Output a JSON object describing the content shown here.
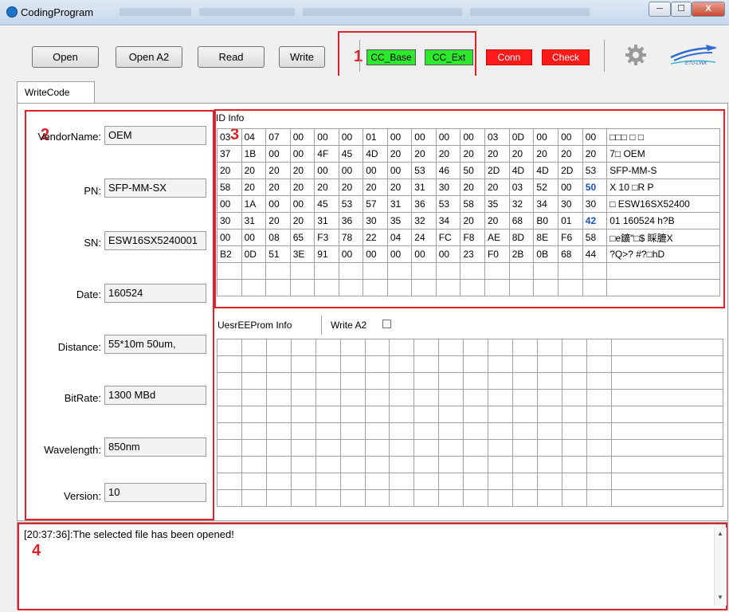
{
  "window": {
    "title": "CodingProgram",
    "controls": [
      "─",
      "☐",
      "X"
    ]
  },
  "toolbar": {
    "buttons": [
      "Open",
      "Open A2",
      "Read",
      "Write"
    ],
    "status": {
      "cc_base": {
        "label": "CC_Base",
        "color": "#2ee82e"
      },
      "cc_ext": {
        "label": "CC_Ext",
        "color": "#2ee82e"
      },
      "conn": {
        "label": "Conn",
        "color": "#ff1a1a"
      },
      "check": {
        "label": "Check",
        "color": "#ff1a1a"
      }
    },
    "logo_text": "ETU-LINK"
  },
  "annotations": [
    "1",
    "2",
    "3",
    "4"
  ],
  "tabs": [
    "WriteCode"
  ],
  "fields": [
    {
      "label": "VendorName:",
      "value": "OEM"
    },
    {
      "label": "PN:",
      "value": "SFP-MM-SX"
    },
    {
      "label": "SN:",
      "value": "ESW16SX5240001"
    },
    {
      "label": "Date:",
      "value": "160524"
    },
    {
      "label": "Distance:",
      "value": "55*10m 50um,"
    },
    {
      "label": "BitRate:",
      "value": "1300 MBd"
    },
    {
      "label": "Wavelength:",
      "value": "850nm"
    },
    {
      "label": "Version:",
      "value": "10"
    }
  ],
  "id_info": {
    "title": "ID Info",
    "rows": [
      {
        "hex": [
          "03",
          "04",
          "07",
          "00",
          "00",
          "00",
          "01",
          "00",
          "00",
          "00",
          "00",
          "03",
          "0D",
          "00",
          "00",
          "00"
        ],
        "text": "□□□  □    □"
      },
      {
        "hex": [
          "37",
          "1B",
          "00",
          "00",
          "4F",
          "45",
          "4D",
          "20",
          "20",
          "20",
          "20",
          "20",
          "20",
          "20",
          "20",
          "20"
        ],
        "text": "7□  OEM"
      },
      {
        "hex": [
          "20",
          "20",
          "20",
          "20",
          "00",
          "00",
          "00",
          "00",
          "53",
          "46",
          "50",
          "2D",
          "4D",
          "4D",
          "2D",
          "53"
        ],
        "text": "          SFP-MM-S"
      },
      {
        "hex": [
          "58",
          "20",
          "20",
          "20",
          "20",
          "20",
          "20",
          "20",
          "31",
          "30",
          "20",
          "20",
          "03",
          "52",
          "00",
          "50"
        ],
        "text": "X         10  □R P"
      },
      {
        "hex": [
          "00",
          "1A",
          "00",
          "00",
          "45",
          "53",
          "57",
          "31",
          "36",
          "53",
          "58",
          "35",
          "32",
          "34",
          "30",
          "30"
        ],
        "text": " □  ESW16SX52400"
      },
      {
        "hex": [
          "30",
          "31",
          "20",
          "20",
          "31",
          "36",
          "30",
          "35",
          "32",
          "34",
          "20",
          "20",
          "68",
          "B0",
          "01",
          "42"
        ],
        "text": "01  160524  h?B"
      },
      {
        "hex": [
          "00",
          "00",
          "08",
          "65",
          "F3",
          "78",
          "22",
          "04",
          "24",
          "FC",
          "F8",
          "AE",
          "8D",
          "8E",
          "F6",
          "58"
        ],
        "text": "  □e鑛\"□$   睬膔X"
      },
      {
        "hex": [
          "B2",
          "0D",
          "51",
          "3E",
          "91",
          "00",
          "00",
          "00",
          "00",
          "00",
          "23",
          "F0",
          "2B",
          "0B",
          "68",
          "44"
        ],
        "text": "?Q>?     #?□hD"
      }
    ],
    "highlight": {
      "row3_col15": "50",
      "row5_col15": "42"
    }
  },
  "user_eeprom": {
    "title": "UesrEEProm Info",
    "write_a2_label": "Write A2",
    "write_a2_checked": false
  },
  "log": {
    "messages": [
      "[20:37:36]:The selected file has been opened!"
    ]
  }
}
